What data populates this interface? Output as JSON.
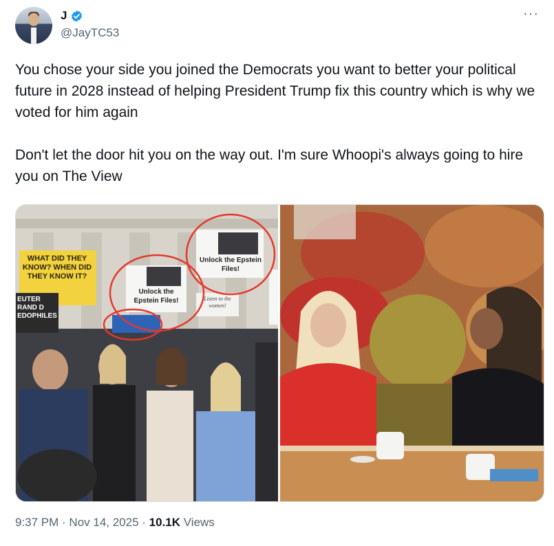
{
  "author": {
    "display_name": "J",
    "handle": "@JayTC53",
    "verified": true
  },
  "tweet": {
    "paragraphs": [
      "You chose your side you joined the Democrats you want to better your political future in 2028 instead of helping President Trump fix this country which is why we voted for him again",
      "Don't let the door hit you on the way out. I'm sure Whoopi's always going to hire you on The View"
    ]
  },
  "media": {
    "left_signs": {
      "yellow_sign": "WHAT DID THEY KNOW? WHEN DID THEY KNOW IT?",
      "epstein_sign_top": "Unlock the Epstein Files!",
      "epstein_sign_mid": "Unlock the Epstein Files!",
      "black_sign": "EUTER RAND D EDOPHILES",
      "small_sign": "Listen to the women!"
    }
  },
  "footer": {
    "time": "9:37 PM",
    "sep1": " · ",
    "date": "Nov 14, 2025",
    "sep2": " · ",
    "views_count": "10.1K",
    "views_label": " Views"
  },
  "colors": {
    "text": "#0f1419",
    "secondary": "#536471",
    "verified_blue": "#1d9bf0"
  },
  "icons": [
    "verified-badge-icon",
    "more-options-icon"
  ]
}
